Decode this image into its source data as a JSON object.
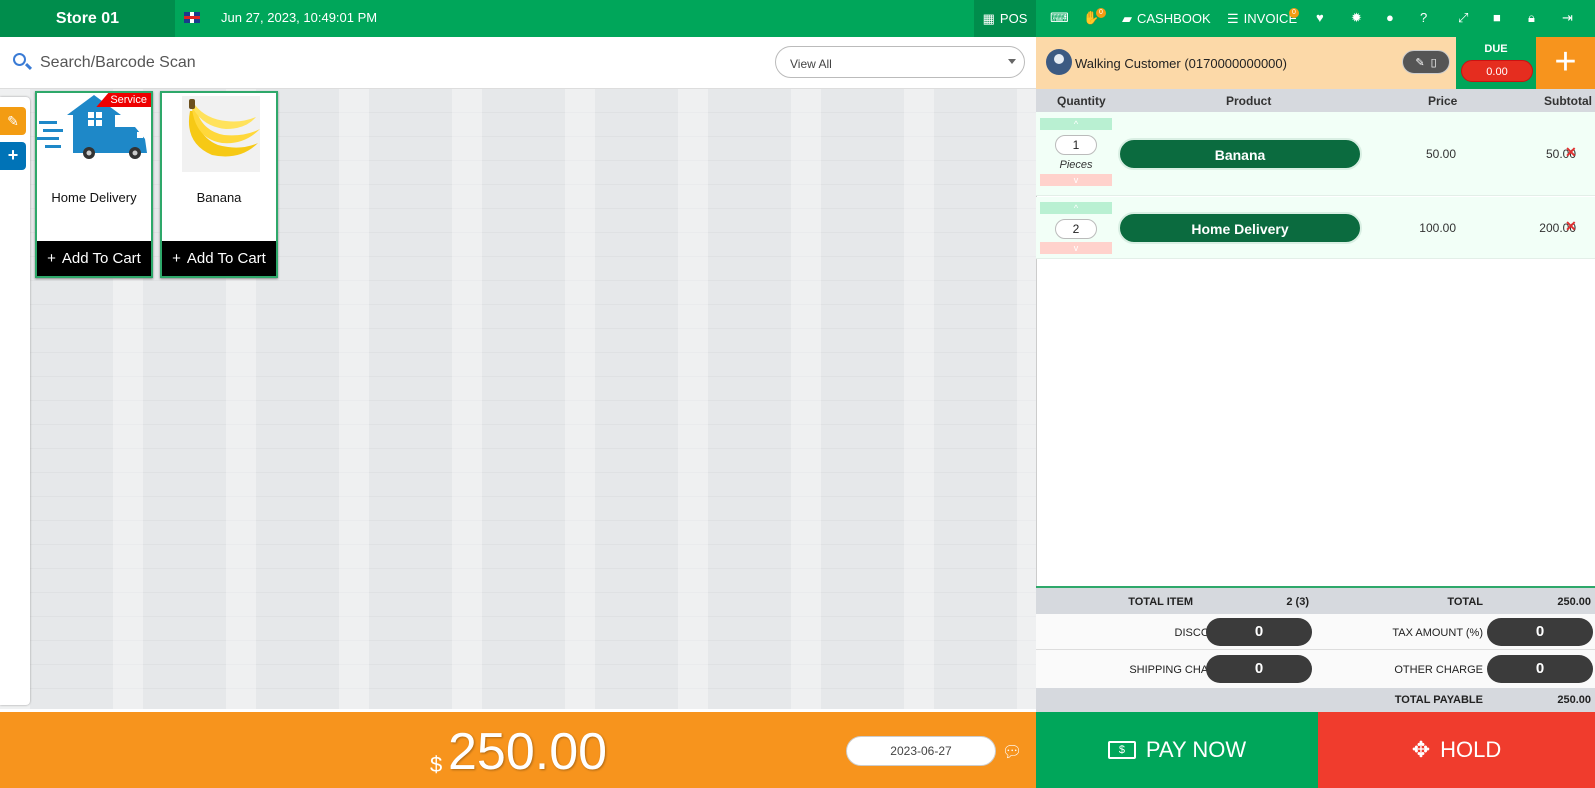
{
  "topbar": {
    "store_name": "Store 01",
    "datetime": "Jun 27, 2023, 10:49:01 PM",
    "pos_label": "POS",
    "hold_badge": "0",
    "cashbook_label": "CASHBOOK",
    "invoice_label": "INVOICE",
    "invoice_badge": "0"
  },
  "search": {
    "placeholder": "Search/Barcode Scan",
    "category_select": "View All"
  },
  "products": [
    {
      "name": "Home Delivery",
      "ribbon": "Service",
      "cart_label": "Add To Cart"
    },
    {
      "name": "Banana",
      "ribbon": "",
      "cart_label": "Add To Cart"
    }
  ],
  "customer": {
    "name": "Walking Customer (0170000000000)",
    "due_label": "DUE",
    "due_value": "0.00"
  },
  "cart": {
    "headers": {
      "quantity": "Quantity",
      "product": "Product",
      "price": "Price",
      "subtotal": "Subtotal"
    },
    "items": [
      {
        "qty": "1",
        "unit": "Pieces",
        "product": "Banana",
        "price": "50.00",
        "subtotal": "50.00"
      },
      {
        "qty": "2",
        "unit": "",
        "product": "Home Delivery",
        "price": "100.00",
        "subtotal": "200.00"
      }
    ]
  },
  "totals": {
    "total_item_label": "TOTAL ITEM",
    "total_item_value": "2 (3)",
    "total_label": "TOTAL",
    "total_value": "250.00",
    "discount_label": "DISCOUNT",
    "discount_value": "0",
    "tax_label": "TAX AMOUNT (%)",
    "tax_value": "0",
    "shipping_label": "SHIPPING CHARGE",
    "shipping_value": "0",
    "other_label": "OTHER CHARGE",
    "other_value": "0",
    "payable_label": "TOTAL PAYABLE",
    "payable_value": "250.00"
  },
  "footer": {
    "currency": "$",
    "amount": "250.00",
    "date": "2023-06-27",
    "pay_now": "PAY NOW",
    "hold": "HOLD"
  },
  "colors": {
    "green": "#00a65a",
    "dark_green": "#008d4c",
    "orange": "#f7941d",
    "red": "#f03c2d"
  }
}
